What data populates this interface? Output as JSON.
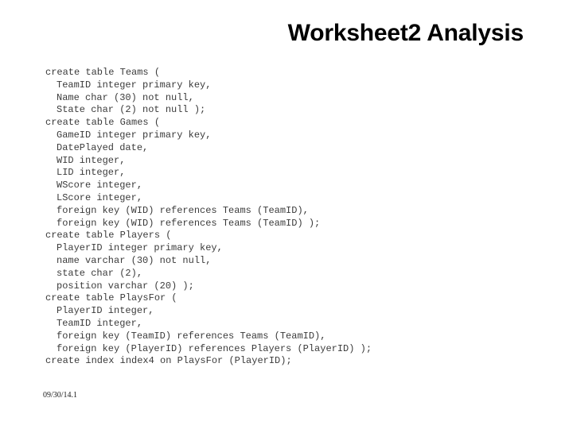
{
  "slide": {
    "title": "Worksheet2 Analysis",
    "footer_date": "09/30/14.1",
    "background_color": "#ffffff",
    "title_color": "#000000",
    "code_color": "#3b3b3b"
  },
  "code": {
    "lines": [
      {
        "text": "create table Teams (",
        "indent": false
      },
      {
        "text": "TeamID integer primary key,",
        "indent": true
      },
      {
        "text": "Name char (30) not null,",
        "indent": true
      },
      {
        "text": "State char (2) not null );",
        "indent": true
      },
      {
        "text": "create table Games (",
        "indent": false
      },
      {
        "text": "GameID integer primary key,",
        "indent": true
      },
      {
        "text": "DatePlayed date,",
        "indent": true
      },
      {
        "text": "WID integer,",
        "indent": true
      },
      {
        "text": "LID integer,",
        "indent": true
      },
      {
        "text": "WScore integer,",
        "indent": true
      },
      {
        "text": "LScore integer,",
        "indent": true
      },
      {
        "text": "foreign key (WID) references Teams (TeamID),",
        "indent": true
      },
      {
        "text": "foreign key (WID) references Teams (TeamID) );",
        "indent": true
      },
      {
        "text": "create table Players (",
        "indent": false
      },
      {
        "text": "PlayerID integer primary key,",
        "indent": true
      },
      {
        "text": "name varchar (30) not null,",
        "indent": true
      },
      {
        "text": "state char (2),",
        "indent": true
      },
      {
        "text": "position varchar (20) );",
        "indent": true
      },
      {
        "text": "create table PlaysFor (",
        "indent": false
      },
      {
        "text": "PlayerID integer,",
        "indent": true
      },
      {
        "text": "TeamID integer,",
        "indent": true
      },
      {
        "text": "foreign key (TeamID) references Teams (TeamID),",
        "indent": true
      },
      {
        "text": "foreign key (PlayerID) references Players (PlayerID) );",
        "indent": true
      },
      {
        "text": "create index index4 on PlaysFor (PlayerID);",
        "indent": false
      }
    ]
  }
}
